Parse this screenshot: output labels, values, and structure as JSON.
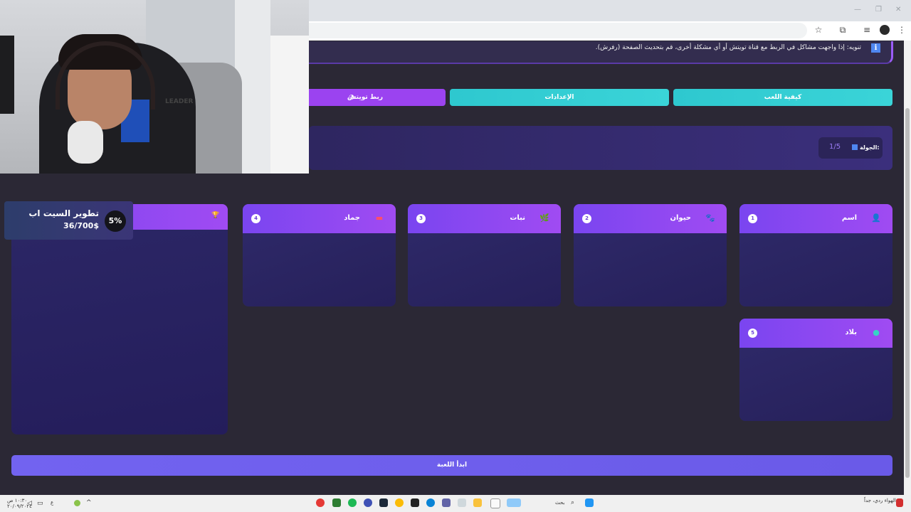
{
  "browser": {
    "window_controls": [
      "—",
      "❐",
      "✕"
    ],
    "toolbar_icons": [
      "star-icon",
      "extensions-icon",
      "media-icon",
      "profile-icon",
      "menu-icon"
    ],
    "menu_glyph": "⋮"
  },
  "alert": {
    "icon_glyph": "i",
    "text": "تنويه: إذا واجهت مشاكل في الربط مع قناة تويتش أو أي مشكلة أخرى، قم بتحديث الصفحة (رفرش)."
  },
  "actions": {
    "how_to_play": "كيفية اللعب",
    "settings": "الإعدادات",
    "twitch_link": "ربط تويتش"
  },
  "round": {
    "label": "الجولة:",
    "value": "1/5"
  },
  "categories": [
    {
      "number": "1",
      "title": "اسم",
      "icon": "person-icon",
      "glyph": "👤"
    },
    {
      "number": "2",
      "title": "حيوان",
      "icon": "paw-icon",
      "glyph": "🐾"
    },
    {
      "number": "3",
      "title": "نبات",
      "icon": "leaf-icon",
      "glyph": "🌿"
    },
    {
      "number": "4",
      "title": "جماد",
      "icon": "object-icon",
      "glyph": "▬"
    },
    {
      "number": "5",
      "title": "بلاد",
      "icon": "globe-icon",
      "glyph": "●"
    }
  ],
  "scoreboard": {
    "icon": "trophy-icon",
    "glyph": "🏆"
  },
  "start_button": "ابدأ اللعبة",
  "webcam": {
    "chair_brand": "LEADER"
  },
  "stream_widget": {
    "title": "تطوير السيت اب",
    "amount": "36/700$",
    "percent": "5%",
    "progress_fraction": 0.05
  },
  "taskbar": {
    "search_label": "بحث",
    "weather_text": "الهواء ردي، جداً",
    "clock": "١٠:٣٠ ص",
    "date": "٢٠/٠٩/٢٠٢٤",
    "lang": "ع"
  },
  "colors": {
    "page_bg": "#2b2835",
    "accent_purple": "#9b43f0",
    "accent_cyan": "#2ec8cf",
    "start_button": "#7263f0",
    "card_header": "#8a48f0"
  }
}
